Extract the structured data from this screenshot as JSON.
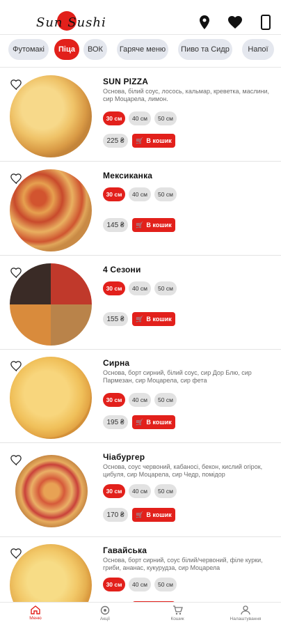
{
  "header": {
    "logo_text": "Sun Sushi",
    "icons": [
      "location-pin-icon",
      "heart-icon",
      "phone-icon"
    ]
  },
  "categories": [
    {
      "label": "Футомакі",
      "active": false
    },
    {
      "label": "Піца",
      "active": true
    },
    {
      "label": "ВОК",
      "active": false
    },
    {
      "label": "Гаряче меню",
      "active": false
    },
    {
      "label": "Пиво та Сидр",
      "active": false
    },
    {
      "label": "Напої",
      "active": false
    }
  ],
  "products": [
    {
      "name": "SUN PIZZA",
      "desc": "Основа, білий соус, лосось, кальмар, креветка, маслини, сир Моцарела, лимон.",
      "sizes": [
        "30 см",
        "40 см",
        "50 см"
      ],
      "price": "225 ₴",
      "cart": "В кошик"
    },
    {
      "name": "Мексиканка",
      "desc": "",
      "sizes": [
        "30 см",
        "40 см",
        "50 см"
      ],
      "price": "145 ₴",
      "cart": "В кошик"
    },
    {
      "name": "4 Сезони",
      "desc": "",
      "sizes": [
        "30 см",
        "40 см",
        "50 см"
      ],
      "price": "155 ₴",
      "cart": "В кошик"
    },
    {
      "name": "Сирна",
      "desc": "Основа, борт сирний, білий соус, сир Дор Блю, сир Пармезан, сир Моцарела, сир фета",
      "sizes": [
        "30 см",
        "40 см",
        "50 см"
      ],
      "price": "195 ₴",
      "cart": "В кошик"
    },
    {
      "name": "Чіабургер",
      "desc": "Основа, соус червоний, кабаносі, бекон, кислий огірок, цибуля, сир Моцарела, сир Чедр, помідор",
      "sizes": [
        "30 см",
        "40 см",
        "50 см"
      ],
      "price": "170 ₴",
      "cart": "В кошик"
    },
    {
      "name": "Гавайська",
      "desc": "Основа, борт сирний, соус білий/червоний, філе курки, гриби, ананас, кукурудза, сир Моцарела",
      "sizes": [
        "30 см",
        "40 см",
        "50 см"
      ],
      "price": "",
      "cart": ""
    }
  ],
  "nav": [
    {
      "label": "Меню",
      "icon": "home-icon",
      "active": true
    },
    {
      "label": "Акції",
      "icon": "promo-icon",
      "active": false
    },
    {
      "label": "Кошик",
      "icon": "cart-icon",
      "active": false
    },
    {
      "label": "Налаштування",
      "icon": "profile-icon",
      "active": false
    }
  ],
  "colors": {
    "accent": "#e2201b",
    "chip": "#e4e7ee"
  }
}
